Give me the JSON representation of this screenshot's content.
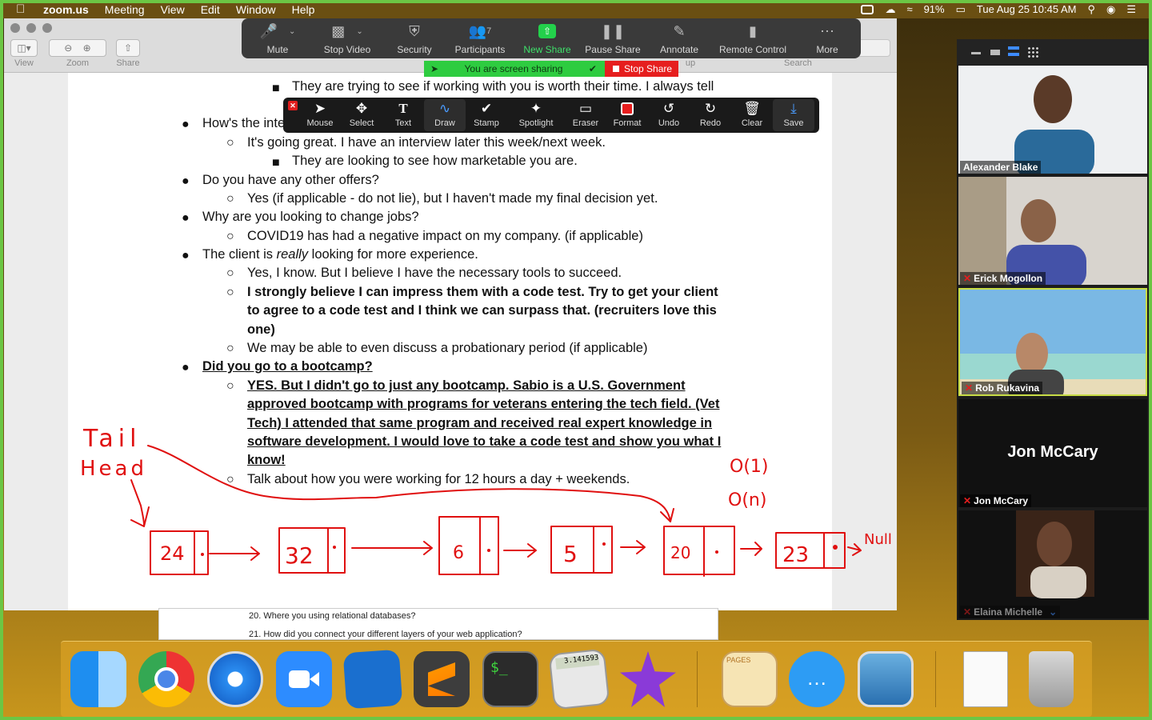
{
  "menubar": {
    "app_name": "zoom.us",
    "menus": [
      "Meeting",
      "View",
      "Edit",
      "Window",
      "Help"
    ],
    "battery": "91%",
    "datetime": "Tue Aug 25  10:45 AM"
  },
  "doc_toolbar": {
    "view_label": "View",
    "zoom_label": "Zoom",
    "share_label": "Share",
    "search_label": "Search",
    "partial_label": "up"
  },
  "zoom_toolbar": {
    "mute": "Mute",
    "stop_video": "Stop Video",
    "security": "Security",
    "participants": "Participants",
    "participants_count": "7",
    "new_share": "New Share",
    "pause_share": "Pause Share",
    "annotate": "Annotate",
    "remote_control": "Remote Control",
    "more": "More"
  },
  "share_banner": {
    "sharing_text": "You are screen sharing",
    "stop_share": "Stop Share"
  },
  "annotation_toolbar": {
    "tools": [
      "Mouse",
      "Select",
      "Text",
      "Draw",
      "Stamp",
      "Spotlight",
      "Eraser",
      "Format",
      "Undo",
      "Redo",
      "Clear",
      "Save"
    ],
    "active_tool": "Draw",
    "format_color": "#e81e1e"
  },
  "document": {
    "line1": "They are trying to see if working with you is worth their time. I always tell",
    "line2": "How's the inte",
    "line3": "It's going great. I have an interview later this week/next week.",
    "line4": "They are looking to see how marketable you are.",
    "line5": "Do you have any other offers?",
    "line6": "Yes (if applicable - do not lie), but I haven't made my final decision yet.",
    "line7": "Why are you looking to change jobs?",
    "line8": "COVID19 has had a negative impact on my company. (if applicable)",
    "line9_a": "The client is ",
    "line9_b": "really",
    "line9_c": " looking for more experience.",
    "line10": "Yes, I know. But I believe I have the necessary tools to succeed.",
    "line11": "I strongly believe I can impress them with a code test. Try to get your client",
    "line12": "to agree to a code test and I think we can surpass that. (recruiters love this",
    "line13": "one)",
    "line14": "We may be able to even discuss a probationary period (if applicable)",
    "line15": "Did you go to a bootcamp?",
    "line16": "YES. But I didn't go to just any bootcamp. Sabio is a U.S. Government",
    "line17": "approved bootcamp with programs for veterans entering the tech field. (Vet",
    "line18": "Tech) I attended that same program and received real expert knowledge in",
    "line19": "software development. I would love to take a code test and show you what I",
    "line20": "know!",
    "line21": "Talk about how you were working for 12 hours a day + weekends.",
    "behind_20": "20.   Where you using relational databases?",
    "behind_21": "21.   How did you connect your different layers of your web application?"
  },
  "annotation": {
    "tail_label": "Tail",
    "head_label": "Head",
    "nodes": [
      "24",
      "32",
      "6",
      "5",
      "20",
      "23"
    ],
    "null_label": "Null",
    "complexity_1": "O(1)",
    "complexity_2": "O(n)",
    "ink_color": "#e01010"
  },
  "participants": [
    {
      "name": "Alexander Blake",
      "muted": false
    },
    {
      "name": "Erick Mogollon",
      "muted": true
    },
    {
      "name": "Rob Rukavina",
      "muted": true
    },
    {
      "name": "Jon McCary",
      "muted": true
    },
    {
      "name": "Elaina Michelle",
      "muted": true
    }
  ],
  "dock_apps": [
    "finder-icon",
    "chrome-icon",
    "safari-icon",
    "zoom-icon",
    "xcode-icon",
    "sublime-text-icon",
    "terminal-icon",
    "calculator-icon",
    "imovie-icon",
    "pages-icon",
    "messages-icon",
    "preview-icon",
    "textedit-document-icon",
    "trash-icon"
  ],
  "calculator_display": "3.141593",
  "pages_label": "PAGES"
}
